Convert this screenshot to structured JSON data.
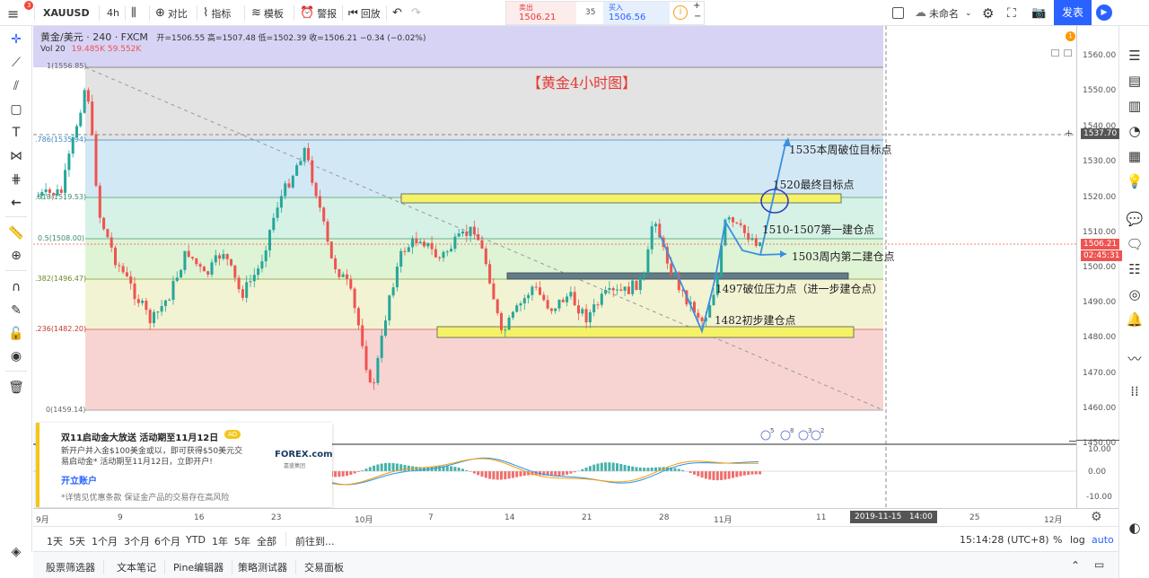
{
  "topbar": {
    "notif_count": "3",
    "symbol": "XAUUSD",
    "interval": "4h",
    "compare_label": "对比",
    "indicators_label": "指标",
    "templates_label": "模板",
    "alert_label": "警报",
    "replay_label": "回放",
    "sell_label": "卖出",
    "sell_price": "1506.21",
    "spread": "35",
    "buy_label": "买入",
    "buy_price": "1506.56",
    "layout_name": "未命名",
    "publish_label": "发表"
  },
  "legend": {
    "title": "黄金/美元 · 240 · FXCM",
    "ohlc": "开=1506.55  高=1507.48  低=1502.39  收=1506.21  −0.34 (−0.02%)",
    "vol_label": "Vol  20",
    "vol_values": "19.485K  59.552K"
  },
  "chart_title": "【黄金4小时图】",
  "fib_labels": [
    "1(1556.85)",
    ".786(1535.94)",
    ".618(1519.53)",
    "0.5(1508.00)",
    ".382(1496.47)",
    ".236(1482.20)",
    "0(1459.14)"
  ],
  "annotations": [
    "1535本周破位目标点",
    "1520最终目标点",
    "1510-1507第一建仓点",
    "1503周内第二建仓点",
    "1497破位压力点（进一步建仓点）",
    "1482初步建仓点"
  ],
  "price_axis": {
    "labels": [
      "1560.00",
      "1550.00",
      "1540.00",
      "1530.00",
      "1520.00",
      "1510.00",
      "1500.00",
      "1490.00",
      "1480.00",
      "1470.00",
      "1460.00",
      "1450.00",
      "10.00",
      "0.00",
      "-10.00"
    ],
    "crosshair_price": "1537.70",
    "last_price": "1506.21",
    "countdown": "02:45:31",
    "alert_badge": "1"
  },
  "time_axis": {
    "labels": [
      "9月",
      "9",
      "16",
      "23",
      "10月",
      "7",
      "14",
      "21",
      "28",
      "11月",
      "11",
      "18",
      "25",
      "12月"
    ],
    "crosshair_time": "2019-11-15   14:00"
  },
  "event_badges": [
    "5",
    "8",
    "3",
    "2"
  ],
  "ad": {
    "title": "双11启动金大放送 活动期至11月12日",
    "badge": "AD",
    "body": "新开户并入金$100美金或以，即可获得$50美元交易启动金* 活动期至11月12日，立即开户!",
    "brand": "FOREX.com",
    "brand_sub": "嘉盛集团",
    "cta": "开立账户",
    "disclaimer": "*详情见优惠条款 保证金产品的交易存在高风险"
  },
  "range_bar": {
    "ranges": [
      "1天",
      "5天",
      "1个月",
      "3个月",
      "6个月",
      "YTD",
      "1年",
      "5年",
      "全部"
    ],
    "goto": "前往到...",
    "time": "15:14:28 (UTC+8)",
    "pct": "%",
    "log": "log",
    "auto": "auto"
  },
  "bottom_tabs": [
    "股票筛选器",
    "文本笔记",
    "Pine编辑器",
    "策略测试器",
    "交易面板"
  ],
  "colors": {
    "accent": "#2962ff",
    "up": "#26a69a",
    "down": "#ef5350",
    "fib_purple": "#d7d3f5",
    "fib_gray": "#e3e3e3",
    "fib_blue": "#d3e8f5",
    "fib_teal": "#d6f1e6",
    "fib_green": "#dff3d5",
    "fib_yellow": "#f2f3d3",
    "fib_red": "#f7d4d2",
    "zone_yellow": "#f4f266",
    "zone_gray": "#607d8b",
    "arrow_blue": "#3b8fe0",
    "title_red": "#e53935"
  }
}
